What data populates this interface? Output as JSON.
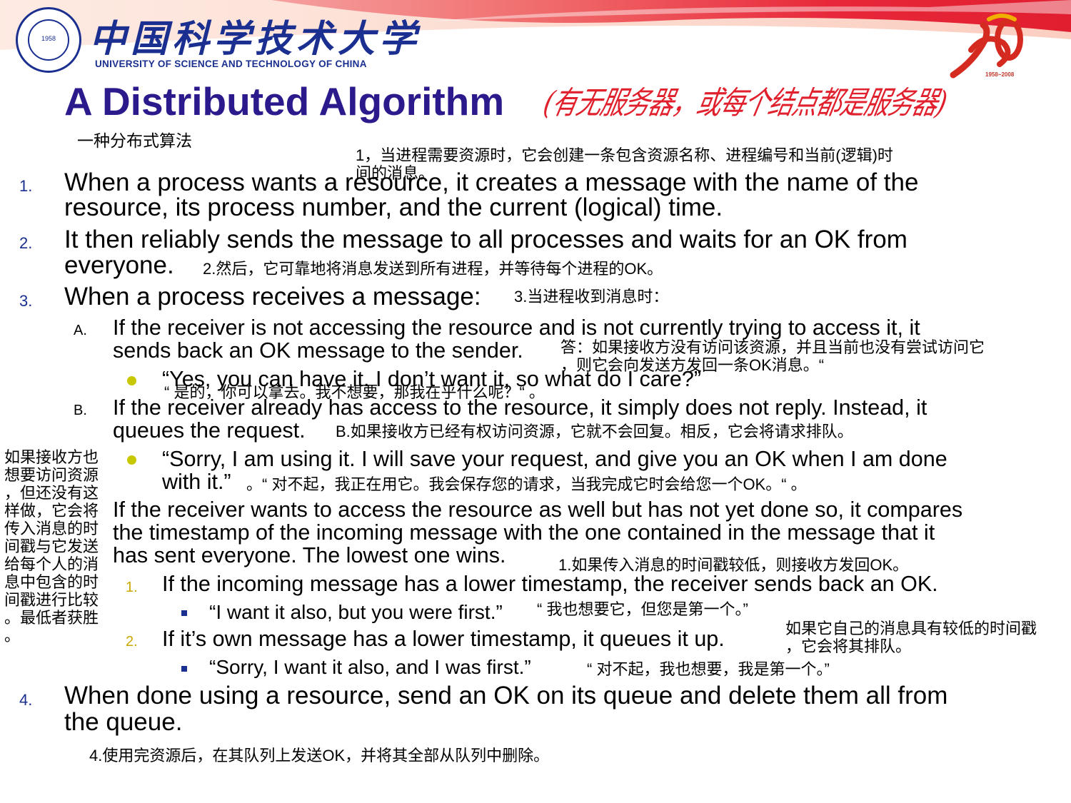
{
  "header": {
    "university_cn": "中国科学技术大学",
    "university_en": "UNIVERSITY OF SCIENCE AND TECHNOLOGY OF CHINA",
    "logo_year": "1958",
    "anniversary_years": "1958~2008",
    "colors": {
      "navy": "#1a2f8f",
      "red": "#e0202c",
      "title_purple": "#2b1a8c",
      "bullet_yellow": "#c8c800"
    }
  },
  "slide": {
    "title": "A Distributed Algorithm",
    "handwritten_note": "(有无服务器，或每个结点都是服务器)",
    "subtitle_cn": "一种分布式算法"
  },
  "steps": {
    "s1": {
      "num": "1.",
      "line1": "When a process wants a resource, it creates a message with the name of the",
      "line2": "resource, its process number, and the current (logical) time.",
      "note_cn1": "1，当进程需要资源时，它会创建一条包含资源名称、进程编号和当前(逻辑)时",
      "note_cn2": "间的消息。"
    },
    "s2": {
      "num": "2.",
      "line1": "It then reliably sends the message to all processes and waits for an OK from",
      "line2": "everyone.",
      "note_cn": "2.然后，它可靠地将消息发送到所有进程，并等待每个进程的OK。"
    },
    "s3": {
      "num": "3.",
      "line1": "When a process receives a message:",
      "note_cn": "3.当进程收到消息时：",
      "a": {
        "num": "A.",
        "line1": "If the receiver is not accessing the resource and is not currently trying to access it, it",
        "line2": "sends back an OK message to the sender.",
        "note_cn1": "答：如果接收方没有访问该资源，并且当前也没有尝试访问它",
        "note_cn2": "，则它会向发送方发回一条OK消息。“",
        "quote": "“Yes, you can have it. I don’t want it, so what do I care?”",
        "quote_cn": "“ 是的，你可以拿去。我不想要，那我在乎什么呢？“ 。"
      },
      "b": {
        "num": "B.",
        "line1": "If the receiver already has access to the resource, it simply does not reply. Instead, it",
        "line2": "queues the request.",
        "note_cn": "B.如果接收方已经有权访问资源，它就不会回复。相反，它会将请求排队。",
        "quote1": "“Sorry, I am using it. I will save your request, and give you an OK when I am done",
        "quote2": "with it.”",
        "quote_cn": "。“ 对不起，我正在用它。我会保存您的请求，当我完成它时会给您一个OK。“ 。"
      },
      "c": {
        "num": "C.",
        "line1": "If the receiver wants to access the resource as well but has not yet done so, it compares",
        "line2": "the timestamp of the incoming message with the one contained in the message that it",
        "line3": "has sent everyone. The lowest one wins.",
        "note_cn": "1.如果传入消息的时间戳较低，则接收方发回OK。",
        "left_note": [
          "如果接收方也",
          "想要访问资源",
          "，但还没有这",
          "样做，它会将",
          "传入消息的时",
          "间戳与它发送",
          "给每个人的消",
          "息中包含的时",
          "间戳进行比较",
          "。最低者获胜",
          "。"
        ],
        "sub1": {
          "num": "1.",
          "line": "If the incoming message has a lower timestamp, the receiver sends back an OK.",
          "quote": "“I want it also, but you were first.”",
          "quote_cn": "“ 我也想要它，但您是第一个。”"
        },
        "sub2": {
          "num": "2.",
          "line": "If it’s own message has a lower timestamp, it queues it up.",
          "note_cn1": "如果它自己的消息具有较低的时间戳",
          "note_cn2": "，它会将其排队。",
          "quote": "“Sorry, I want it also, and I was first.”",
          "quote_cn": "“ 对不起，我也想要，我是第一个。”"
        }
      }
    },
    "s4": {
      "num": "4.",
      "line1": "When done using a resource, send an OK on its queue and delete them all from",
      "line2": "the queue.",
      "note_cn": "4.使用完资源后，在其队列上发送OK，并将其全部从队列中删除。"
    }
  }
}
